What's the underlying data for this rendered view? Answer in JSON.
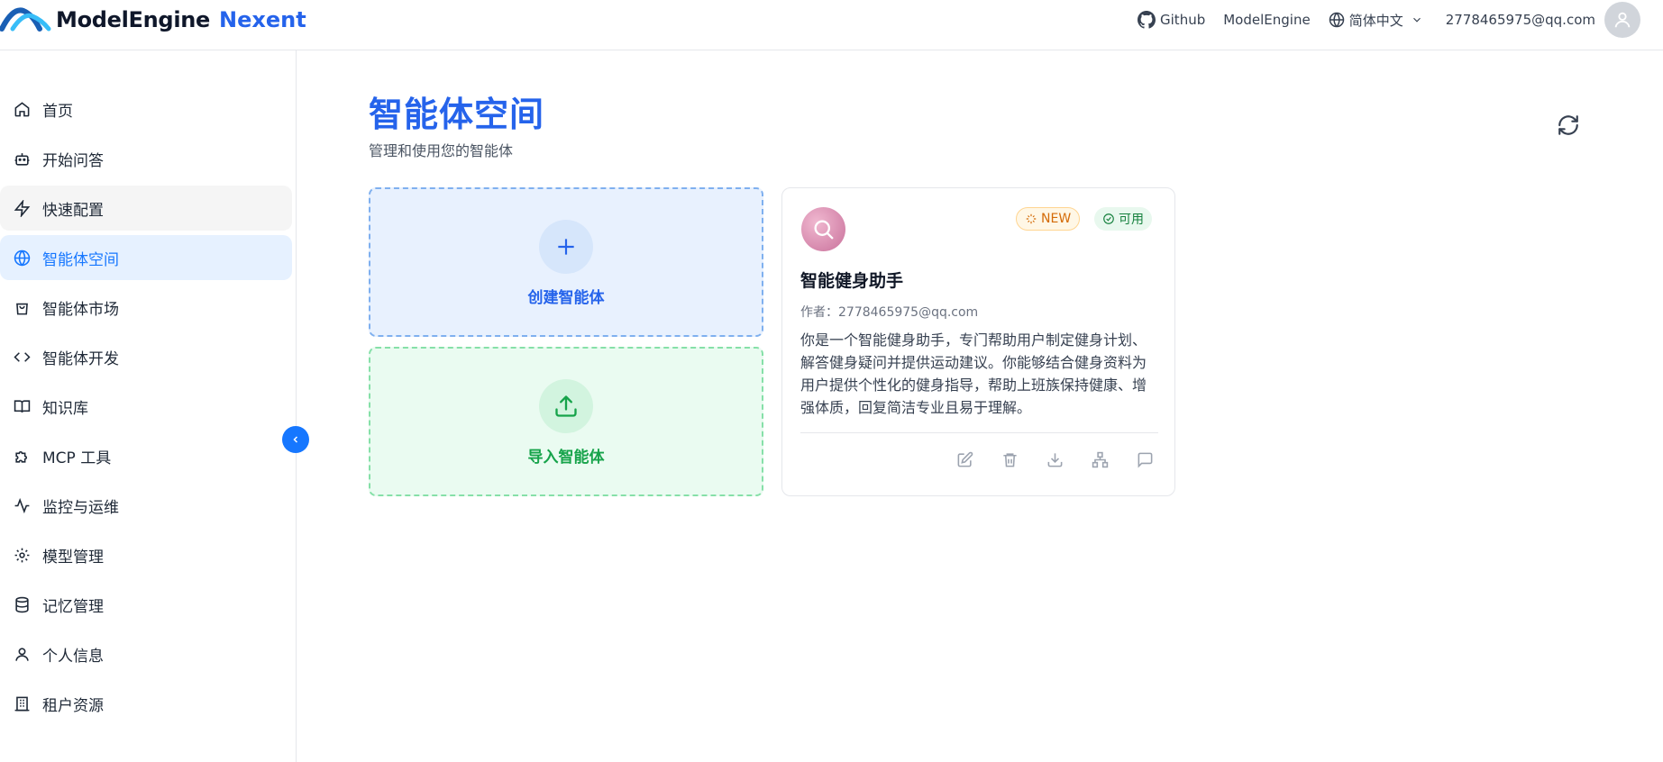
{
  "header": {
    "brand": "ModelEngine",
    "brand_accent": "Nexent",
    "links": {
      "github": "Github",
      "modelengine": "ModelEngine",
      "language": "简体中文"
    },
    "user_email": "2778465975@qq.com",
    "icons": {
      "github": "github-icon",
      "globe": "globe-icon",
      "chevron": "chevron-down-icon",
      "avatar": "user-icon"
    }
  },
  "sidebar": {
    "items": [
      {
        "label": "首页",
        "icon": "home-icon"
      },
      {
        "label": "开始问答",
        "icon": "bot-icon"
      },
      {
        "label": "快速配置",
        "icon": "zap-icon"
      },
      {
        "label": "智能体空间",
        "icon": "globe-icon"
      },
      {
        "label": "智能体市场",
        "icon": "shopping-bag-icon"
      },
      {
        "label": "智能体开发",
        "icon": "code-icon"
      },
      {
        "label": "知识库",
        "icon": "book-icon"
      },
      {
        "label": "MCP 工具",
        "icon": "puzzle-icon"
      },
      {
        "label": "监控与运维",
        "icon": "activity-icon"
      },
      {
        "label": "模型管理",
        "icon": "gear-icon"
      },
      {
        "label": "记忆管理",
        "icon": "database-icon"
      },
      {
        "label": "个人信息",
        "icon": "user-icon"
      },
      {
        "label": "租户资源",
        "icon": "building-icon"
      }
    ],
    "active_index": 3,
    "hover_index": 2
  },
  "main": {
    "title": "智能体空间",
    "subtitle": "管理和使用您的智能体",
    "create_label": "创建智能体",
    "import_label": "导入智能体"
  },
  "agent": {
    "name": "智能健身助手",
    "author": "作者：2778465975@qq.com",
    "description": "你是一个智能健身助手，专门帮助用户制定健身计划、解答健身疑问并提供运动建议。你能够结合健身资料为用户提供个性化的健身指导，帮助上班族保持健康、增强体质，回复简洁专业且易于理解。",
    "badge_new": "NEW",
    "badge_status": "可用",
    "actions": [
      "edit-icon",
      "trash-icon",
      "download-icon",
      "sitemap-icon",
      "message-icon"
    ]
  },
  "colors": {
    "primary": "#2563eb",
    "active_bg": "#e6f1ff",
    "create_bg": "#e8f1fe",
    "import_bg": "#eafbf1",
    "success": "#16a34a"
  }
}
